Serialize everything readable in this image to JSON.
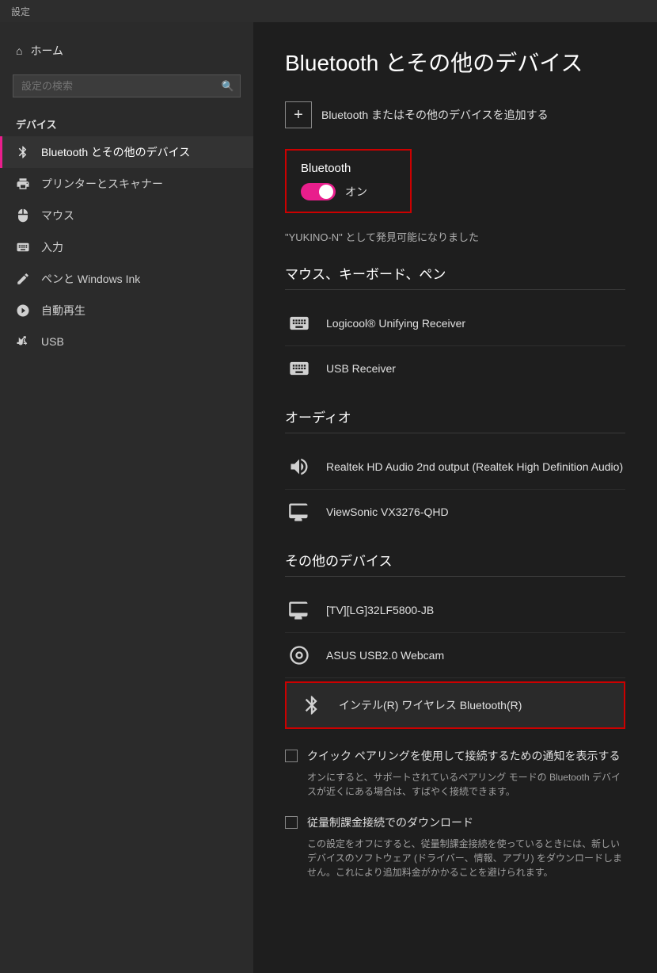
{
  "titleBar": {
    "label": "設定"
  },
  "sidebar": {
    "homeLabel": "ホーム",
    "searchPlaceholder": "設定の検索",
    "sectionLabel": "デバイス",
    "items": [
      {
        "id": "bluetooth",
        "label": "Bluetooth とその他のデバイス",
        "active": true,
        "icon": "bluetooth"
      },
      {
        "id": "printers",
        "label": "プリンターとスキャナー",
        "active": false,
        "icon": "printer"
      },
      {
        "id": "mouse",
        "label": "マウス",
        "active": false,
        "icon": "mouse"
      },
      {
        "id": "input",
        "label": "入力",
        "active": false,
        "icon": "keyboard"
      },
      {
        "id": "pen",
        "label": "ペンと Windows Ink",
        "active": false,
        "icon": "pen"
      },
      {
        "id": "autoplay",
        "label": "自動再生",
        "active": false,
        "icon": "autoplay"
      },
      {
        "id": "usb",
        "label": "USB",
        "active": false,
        "icon": "usb"
      }
    ]
  },
  "main": {
    "pageTitle": "Bluetooth とその他のデバイス",
    "addDeviceLabel": "Bluetooth またはその他のデバイスを追加する",
    "bluetooth": {
      "label": "Bluetooth",
      "toggleState": "オン",
      "discoverableText": "\"YUKINO-N\" として発見可能になりました"
    },
    "sections": [
      {
        "id": "mouse-keyboard-pen",
        "title": "マウス、キーボード、ペン",
        "devices": [
          {
            "id": "logicool",
            "name": "Logicool® Unifying Receiver",
            "icon": "keyboard"
          },
          {
            "id": "usb-receiver",
            "name": "USB Receiver",
            "icon": "keyboard"
          }
        ]
      },
      {
        "id": "audio",
        "title": "オーディオ",
        "devices": [
          {
            "id": "realtek",
            "name": "Realtek HD Audio 2nd output (Realtek High Definition Audio)",
            "icon": "speaker"
          },
          {
            "id": "viewsonic",
            "name": "ViewSonic VX3276-QHD",
            "icon": "monitor"
          }
        ]
      },
      {
        "id": "other-devices",
        "title": "その他のデバイス",
        "devices": [
          {
            "id": "tv-lg",
            "name": "[TV][LG]32LF5800-JB",
            "icon": "monitor",
            "highlighted": false
          },
          {
            "id": "asus-webcam",
            "name": "ASUS USB2.0 Webcam",
            "icon": "webcam",
            "highlighted": false
          },
          {
            "id": "intel-bluetooth",
            "name": "インテル(R) ワイヤレス Bluetooth(R)",
            "icon": "bluetooth",
            "highlighted": true
          }
        ]
      }
    ],
    "checkboxes": [
      {
        "id": "quick-pairing",
        "label": "クイック ペアリングを使用して接続するための通知を表示する",
        "description": "オンにすると、サポートされているペアリング モードの Bluetooth デバイスが近くにある場合は、すばやく接続できます。",
        "checked": false
      },
      {
        "id": "metered-connection",
        "label": "従量制課金接続でのダウンロード",
        "description": "この設定をオフにすると、従量制課金接続を使っているときには、新しいデバイスのソフトウェア (ドライバー、情報、アプリ) をダウンロードしません。これにより追加料金がかかることを避けられます。",
        "checked": false
      }
    ]
  }
}
